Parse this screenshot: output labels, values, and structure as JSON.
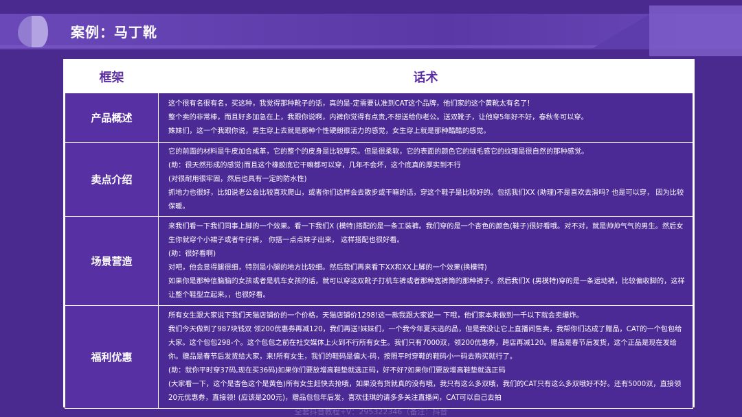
{
  "slide": {
    "title": "案例：马丁靴"
  },
  "table": {
    "headers": {
      "frame": "框架",
      "speech": "话术"
    },
    "rows": [
      {
        "frame": "产品概述",
        "lines": [
          "这个很有名很有名，买这种，我觉得那种靴子的话，真的是-定需要认准到CAT这个品牌，他们家的这个黄靴太有名了!",
          "整个卖的非常棒，而且好多加急在上，我跟你说啊，内裤你觉得有点贵,不想送给你老公。送双靴子，让他穿5年好不好，春秋冬可以穿。",
          "姝妹们，这一个我跟你说，男生穿上去就是那种个性硬朗很活力的感觉，女生穿上就是那种酷酷的感觉。"
        ]
      },
      {
        "frame": "卖点介绍",
        "lines": [
          "它的前面的材料是牛皮加合成革，它的整个的皮身是比较厚实。但是很柔软，它的表面的颜色它的绒毛感它的纹理是很自然的那种感觉。",
          "(助：很天然形成的感觉)而且这个橡胶底它干嘛都可以穿，几年不会坏，这个底真的厚实到不行",
          "(对很耐用很牢固，然后也具有一定的防水性)",
          "抓地力也很好，比如说老公会比较喜欢爬山，或者你们这样会去散步或干嘛的话，穿这个鞋子是比较好的。包括我们XX (助理)不是喜欢去滑吗? 也是可以穿， 因为比较保暖。"
        ]
      },
      {
        "frame": "场景营造",
        "lines": [
          "来我们看一下我们同事上脚的一个效果。看一下我们X (模特)搭配的是一条工装裤。我们穿的是一个杏色的颜色(鞋子)很好看哦。对不对，就是帅帅气气的男生。然后女生你就穿个小裙子或者牛仔裤， 你搭一点点袜子出来， 这样搭配也很好看。",
          "(助：很好看啊)",
          "对吧，他会显得腿很细，特别是小腿的地方比较细。然后我们再来看下XX和XX上脚的一个效果(换模特)",
          "如果你是那种信脑脑的女孩或者是机车女孩的话，就可以穿这双靴子打机车裤或者那种宽裤筒的那种裤子。然后我们X (男模特)穿的是一条运动裤，比较偏收脚的，这样让整个鞋型立起来。，也很好看。"
        ]
      },
      {
        "frame": "福利优惠",
        "lines": [
          "所有女生跟大家说下我们天猫店铺价的一个价格，天猫店铺价1298!这一款我跟大家说一 下哦，他们家本来做到一千以下就会卖爆炸。",
          "我们今天做到了987块钱双 领200优惠券再减120，我们再送!妹妹们，一个我今年夏天选的品，但是我没让它上直播间售卖，我帮你们达成了赠品，CAT的一个包包给大家。这个包包298-个。这个包包之前在社交媒体上火到不行所有女生。我们只有7000双，领200优惠券，跨店再减120。赠品是春节后发货，这个正品是现在发给你。赠品是春节后发货给大家，来!所有女生，我们的鞋码是偏大-码，按照平时穿鞋的鞋码小一码去购买就行了。",
          "(助：就你平时穿37码,现在买36码)如果你们要放增高鞋垫就选正码，好不好?如果你们要放增高鞋垫就选正码",
          "(大家看一下，这个是杏色这个是黄色)所有女生赶快去抢哦，如果没有货就真的没有哦，我只有这么多双哦，我们的CAT只有这么多双哦好不好。还有5000双，直接领20元优惠券，直接领! (应该是200元)，赠品包包年后发，喜欢佳琪的请多多关注直播间，CAT可以自己去拍"
        ]
      }
    ]
  },
  "footer": {
    "watermark": "全套抖音教程+V：295322346（备注：抖音"
  }
}
